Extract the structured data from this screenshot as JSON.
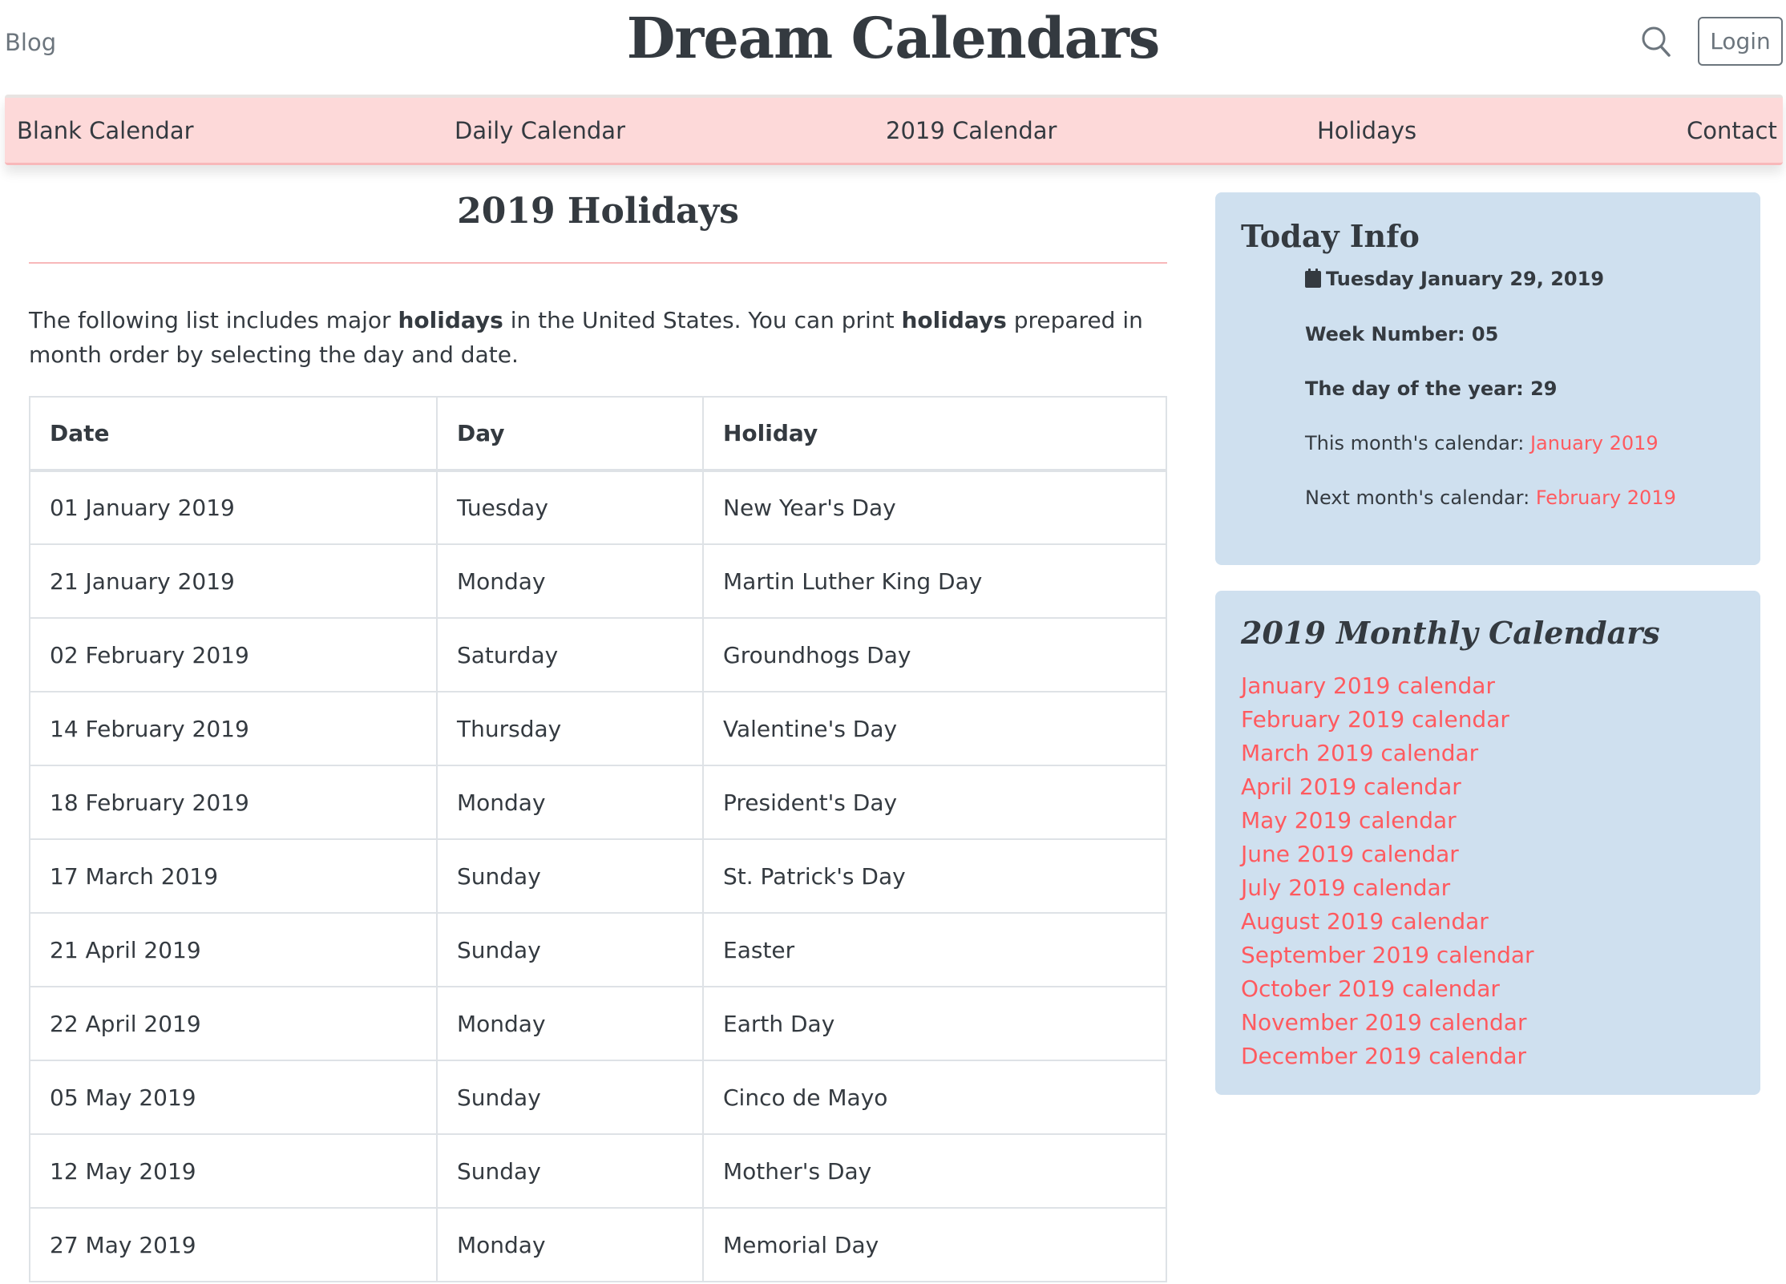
{
  "header": {
    "blog_label": "Blog",
    "site_title": "Dream Calendars",
    "login_label": "Login",
    "search_icon": "search-icon"
  },
  "nav": {
    "items": [
      {
        "label": "Blank Calendar"
      },
      {
        "label": "Daily Calendar"
      },
      {
        "label": "2019 Calendar"
      },
      {
        "label": "Holidays"
      },
      {
        "label": "Contact"
      }
    ]
  },
  "main": {
    "title": "2019 Holidays",
    "intro": {
      "part1": "The following list includes major ",
      "bold1": "holidays",
      "part2": " in the United States. You can print ",
      "bold2": "holidays",
      "part3": " prepared in month order by selecting the day and date."
    },
    "table": {
      "headers": [
        "Date",
        "Day",
        "Holiday"
      ],
      "rows": [
        [
          "01 January 2019",
          "Tuesday",
          "New Year's Day"
        ],
        [
          "21 January 2019",
          "Monday",
          "Martin Luther King Day"
        ],
        [
          "02 February 2019",
          "Saturday",
          "Groundhogs Day"
        ],
        [
          "14 February 2019",
          "Thursday",
          "Valentine's Day"
        ],
        [
          "18 February 2019",
          "Monday",
          "President's Day"
        ],
        [
          "17 March 2019",
          "Sunday",
          "St. Patrick's Day"
        ],
        [
          "21 April 2019",
          "Sunday",
          "Easter"
        ],
        [
          "22 April 2019",
          "Monday",
          "Earth Day"
        ],
        [
          "05 May 2019",
          "Sunday",
          "Cinco de Mayo"
        ],
        [
          "12 May 2019",
          "Sunday",
          "Mother's Day"
        ],
        [
          "27 May 2019",
          "Monday",
          "Memorial Day"
        ]
      ]
    }
  },
  "sidebar": {
    "today": {
      "title": "Today Info",
      "date": "Tuesday January 29, 2019",
      "week_number": "Week Number: 05",
      "day_of_year": "The day of the year: 29",
      "this_month_label": "This month's calendar: ",
      "this_month_link": "January 2019",
      "next_month_label": "Next month's calendar: ",
      "next_month_link": "February 2019"
    },
    "monthly": {
      "title": "2019 Monthly Calendars",
      "links": [
        "January 2019 calendar",
        "February 2019 calendar",
        "March 2019 calendar",
        "April 2019 calendar",
        "May 2019 calendar",
        "June 2019 calendar",
        "July 2019 calendar",
        "August 2019 calendar",
        "September 2019 calendar",
        "October 2019 calendar",
        "November 2019 calendar",
        "December 2019 calendar"
      ]
    }
  },
  "colors": {
    "accent_link": "#ff5a5f",
    "nav_bg": "#fdd9d9",
    "sidebar_bg": "#cfe0ef",
    "text": "#343a40",
    "muted": "#6c757d"
  }
}
